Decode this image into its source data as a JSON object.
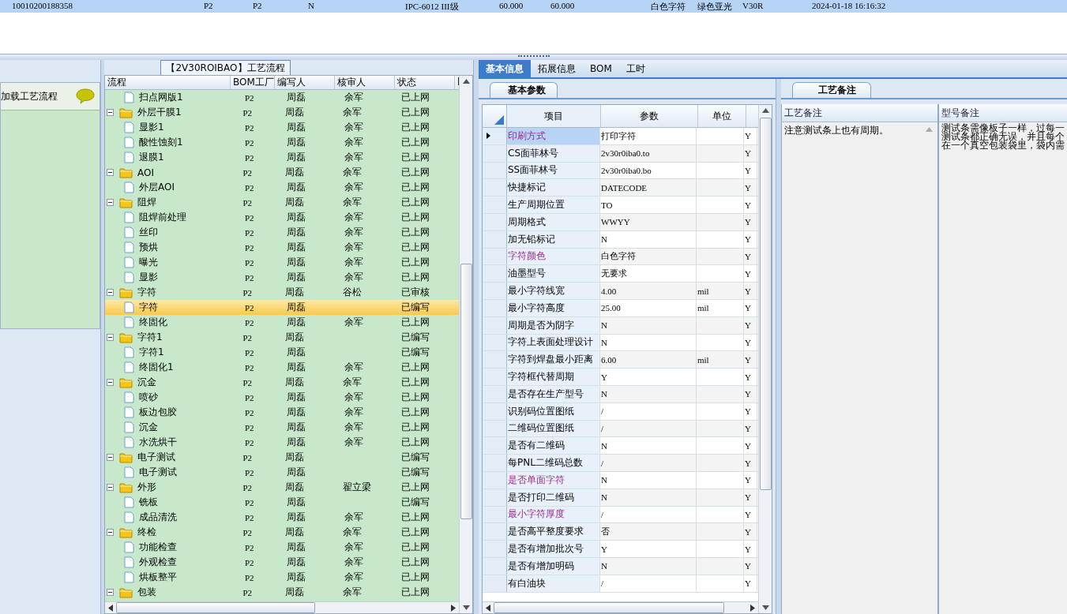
{
  "top_row": {
    "selected": true,
    "cells": [
      "10010200188358",
      "P2",
      "P2",
      "N",
      "IPC-6012 III级",
      "60.000",
      "60.000",
      "白色字符",
      "绿色亚光",
      "V30R",
      "2024-01-18 16:16:32"
    ]
  },
  "left_panel": {
    "item": "加载工艺流程"
  },
  "flow_tab": "【2V30ROIBAO】工艺流程",
  "tree": {
    "columns": [
      "流程",
      "BOM工厂",
      "编写人",
      "核审人",
      "状态",
      "l"
    ],
    "rows": [
      {
        "children": [
          {
            "name": "扫点网版1",
            "bom": "P2",
            "writer": "周磊",
            "reviewer": "余军",
            "status": "已上网",
            "selected": false
          }
        ]
      },
      {
        "name": "外层干膜1",
        "bom": "P2",
        "writer": "周磊",
        "reviewer": "余军",
        "status": "已上网",
        "selected": false,
        "expanded": true,
        "children": [
          {
            "name": "显影1",
            "bom": "P2",
            "writer": "周磊",
            "reviewer": "余军",
            "status": "已上网",
            "selected": false
          },
          {
            "name": "酸性蚀刻1",
            "bom": "P2",
            "writer": "周磊",
            "reviewer": "余军",
            "status": "已上网",
            "selected": false
          },
          {
            "name": "退膜1",
            "bom": "P2",
            "writer": "周磊",
            "reviewer": "余军",
            "status": "已上网",
            "selected": false
          }
        ]
      },
      {
        "name": "AOI",
        "bom": "P2",
        "writer": "周磊",
        "reviewer": "余军",
        "status": "已上网",
        "selected": false,
        "expanded": true,
        "children": [
          {
            "name": "外层AOI",
            "bom": "P2",
            "writer": "周磊",
            "reviewer": "余军",
            "status": "已上网",
            "selected": false
          }
        ]
      },
      {
        "name": "阻焊",
        "bom": "P2",
        "writer": "周磊",
        "reviewer": "余军",
        "status": "已上网",
        "selected": false,
        "expanded": true,
        "children": [
          {
            "name": "阻焊前处理",
            "bom": "P2",
            "writer": "周磊",
            "reviewer": "余军",
            "status": "已上网",
            "selected": false
          },
          {
            "name": "丝印",
            "bom": "P2",
            "writer": "周磊",
            "reviewer": "余军",
            "status": "已上网",
            "selected": false
          },
          {
            "name": "预烘",
            "bom": "P2",
            "writer": "周磊",
            "reviewer": "余军",
            "status": "已上网",
            "selected": false
          },
          {
            "name": "曝光",
            "bom": "P2",
            "writer": "周磊",
            "reviewer": "余军",
            "status": "已上网",
            "selected": false
          },
          {
            "name": "显影",
            "bom": "P2",
            "writer": "周磊",
            "reviewer": "余军",
            "status": "已上网",
            "selected": false
          }
        ]
      },
      {
        "name": "字符",
        "bom": "P2",
        "writer": "周磊",
        "reviewer": "谷松",
        "status": "已审核",
        "selected": false,
        "expanded": true,
        "children": [
          {
            "name": "字符",
            "bom": "P2",
            "writer": "周磊",
            "status": "已编写",
            "selected": true
          },
          {
            "name": "终固化",
            "bom": "P2",
            "writer": "周磊",
            "reviewer": "余军",
            "status": "已上网",
            "selected": false
          }
        ]
      },
      {
        "name": "字符1",
        "bom": "P2",
        "writer": "周磊",
        "status": "已编写",
        "selected": false,
        "expanded": true,
        "children": [
          {
            "name": "字符1",
            "bom": "P2",
            "writer": "周磊",
            "status": "已编写",
            "selected": false
          },
          {
            "name": "终固化1",
            "bom": "P2",
            "writer": "周磊",
            "reviewer": "余军",
            "status": "已上网",
            "selected": false
          }
        ]
      },
      {
        "name": "沉金",
        "bom": "P2",
        "writer": "周磊",
        "reviewer": "余军",
        "status": "已上网",
        "selected": false,
        "expanded": true,
        "children": [
          {
            "name": "喷砂",
            "bom": "P2",
            "writer": "周磊",
            "reviewer": "余军",
            "status": "已上网",
            "selected": false
          },
          {
            "name": "板边包胶",
            "bom": "P2",
            "writer": "周磊",
            "reviewer": "余军",
            "status": "已上网",
            "selected": false
          },
          {
            "name": "沉金",
            "bom": "P2",
            "writer": "周磊",
            "reviewer": "余军",
            "status": "已上网",
            "selected": false
          },
          {
            "name": "水洗烘干",
            "bom": "P2",
            "writer": "周磊",
            "reviewer": "余军",
            "status": "已上网",
            "selected": false
          }
        ]
      },
      {
        "name": "电子测试",
        "bom": "P2",
        "writer": "周磊",
        "status": "已编写",
        "selected": false,
        "expanded": true,
        "children": [
          {
            "name": "电子测试",
            "bom": "P2",
            "writer": "周磊",
            "status": "已编写",
            "selected": false
          }
        ]
      },
      {
        "name": "外形",
        "bom": "P2",
        "writer": "周磊",
        "reviewer": "翟立梁",
        "status": "已上网",
        "selected": false,
        "expanded": true,
        "children": [
          {
            "name": "铣板",
            "bom": "P2",
            "writer": "周磊",
            "status": "已编写",
            "selected": false
          },
          {
            "name": "成品清洗",
            "bom": "P2",
            "writer": "周磊",
            "reviewer": "余军",
            "status": "已上网",
            "selected": false
          }
        ]
      },
      {
        "name": "终检",
        "bom": "P2",
        "writer": "周磊",
        "reviewer": "余军",
        "status": "已上网",
        "selected": false,
        "expanded": true,
        "children": [
          {
            "name": "功能检查",
            "bom": "P2",
            "writer": "周磊",
            "reviewer": "余军",
            "status": "已上网",
            "selected": false
          },
          {
            "name": "外观检查",
            "bom": "P2",
            "writer": "周磊",
            "reviewer": "余军",
            "status": "已上网",
            "selected": false
          },
          {
            "name": "烘板整平",
            "bom": "P2",
            "writer": "周磊",
            "reviewer": "余军",
            "status": "已上网",
            "selected": false
          }
        ]
      },
      {
        "name": "包装",
        "bom": "P2",
        "writer": "周磊",
        "reviewer": "余军",
        "status": "已上网",
        "selected": false,
        "expanded": true
      }
    ]
  },
  "tabs": [
    {
      "label": "基本信息",
      "selected": true
    },
    {
      "label": "拓展信息",
      "selected": false
    },
    {
      "label": "BOM",
      "selected": false
    },
    {
      "label": "工时",
      "selected": false
    }
  ],
  "params_tab": "基本参数",
  "params": {
    "columns": [
      "项目",
      "参数",
      "单位"
    ],
    "rows": [
      {
        "item": "印刷方式",
        "value": "打印字符",
        "flag": "Y",
        "highlighted": true,
        "selected": true
      },
      {
        "item": "CS面菲林号",
        "value": "2v30r0iba0.to",
        "flag": "Y",
        "highlighted": false,
        "selected": false
      },
      {
        "item": "SS面菲林号",
        "value": "2v30r0iba0.bo",
        "flag": "Y",
        "highlighted": false,
        "selected": false
      },
      {
        "item": "快捷标记",
        "value": "DATECODE",
        "flag": "Y",
        "highlighted": false,
        "selected": false
      },
      {
        "item": "生产周期位置",
        "value": "TO",
        "flag": "Y",
        "highlighted": false,
        "selected": false
      },
      {
        "item": "周期格式",
        "value": "WWYY",
        "flag": "Y",
        "highlighted": false,
        "selected": false
      },
      {
        "item": "加无铅标记",
        "value": "N",
        "flag": "Y",
        "highlighted": false,
        "selected": false
      },
      {
        "item": "字符颜色",
        "value": "白色字符",
        "flag": "Y",
        "highlighted": true,
        "selected": false
      },
      {
        "item": "油墨型号",
        "value": "无要求",
        "flag": "Y",
        "highlighted": false,
        "selected": false
      },
      {
        "item": "最小字符线宽",
        "value": "4.00",
        "unit": "mil",
        "flag": "Y",
        "highlighted": false,
        "selected": false
      },
      {
        "item": "最小字符高度",
        "value": "25.00",
        "unit": "mil",
        "flag": "Y",
        "highlighted": false,
        "selected": false
      },
      {
        "item": "周期是否为阴字",
        "value": "N",
        "flag": "Y",
        "highlighted": false,
        "selected": false
      },
      {
        "item": "字符上表面处理设计",
        "value": "N",
        "flag": "Y",
        "highlighted": false,
        "selected": false
      },
      {
        "item": "字符到焊盘最小距离",
        "value": "6.00",
        "unit": "mil",
        "flag": "Y",
        "highlighted": false,
        "selected": false
      },
      {
        "item": "字符框代替周期",
        "value": "Y",
        "flag": "Y",
        "highlighted": false,
        "selected": false
      },
      {
        "item": "是否存在生产型号",
        "value": "N",
        "flag": "Y",
        "highlighted": false,
        "selected": false
      },
      {
        "item": "识别码位置图纸",
        "value": "/",
        "flag": "Y",
        "highlighted": false,
        "selected": false
      },
      {
        "item": "二维码位置图纸",
        "value": "/",
        "flag": "Y",
        "highlighted": false,
        "selected": false
      },
      {
        "item": "是否有二维码",
        "value": "N",
        "flag": "Y",
        "highlighted": false,
        "selected": false
      },
      {
        "item": "每PNL二维码总数",
        "value": "/",
        "flag": "Y",
        "highlighted": false,
        "selected": false
      },
      {
        "item": "是否单面字符",
        "value": "N",
        "flag": "Y",
        "highlighted": true,
        "selected": false
      },
      {
        "item": "是否打印二维码",
        "value": "N",
        "flag": "Y",
        "highlighted": false,
        "selected": false
      },
      {
        "item": "最小字符厚度",
        "value": "/",
        "flag": "Y",
        "highlighted": true,
        "selected": false
      },
      {
        "item": "是否高平整度要求",
        "value": "否",
        "flag": "Y",
        "highlighted": false,
        "selected": false
      },
      {
        "item": "是否有增加批次号",
        "value": "Y",
        "flag": "Y",
        "highlighted": false,
        "selected": false
      },
      {
        "item": "是否有增加明码",
        "value": "N",
        "flag": "Y",
        "highlighted": false,
        "selected": false
      },
      {
        "item": "有白油块",
        "value": "/",
        "flag": "Y",
        "highlighted": false,
        "selected": false
      }
    ]
  },
  "notes_tab": "工艺备注",
  "notes": {
    "columns": [
      "工艺备注",
      "型号备注"
    ],
    "process_note": "注意测试条上也有周期。",
    "model_note": [
      "测试条需像板子一样，过每一",
      "测试条都正确无误，并且每个",
      "在一个真空包装袋里，袋内需"
    ]
  }
}
